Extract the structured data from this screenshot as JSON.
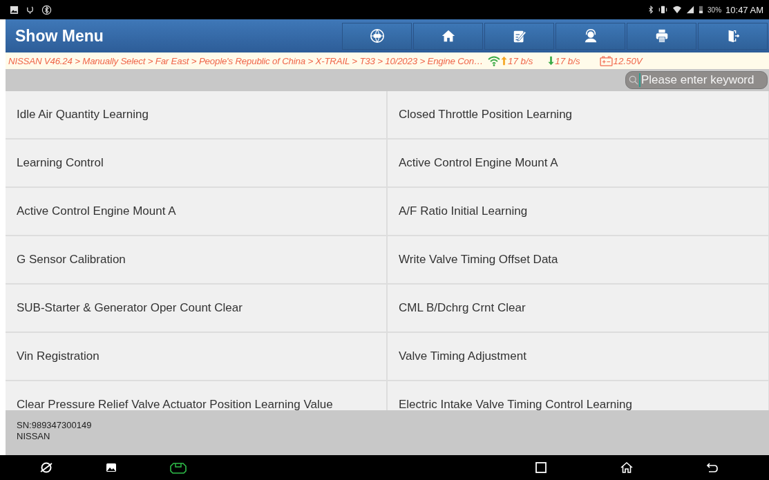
{
  "status_bar": {
    "battery": "30%",
    "time": "10:47 AM"
  },
  "header": {
    "title": "Show Menu"
  },
  "info_bar": {
    "breadcrumb": "NISSAN V46.24 > Manually Select > Far East > People's Republic of China > X-TRAIL > T33 > 10/2023 > Engine Con…",
    "upload": "17 b/s",
    "download": "17 b/s",
    "voltage": "12.50V"
  },
  "search": {
    "placeholder": "Please enter keyword"
  },
  "menu_items": [
    {
      "label": "Idle Air Quantity Learning"
    },
    {
      "label": "Closed Throttle Position Learning"
    },
    {
      "label": "Learning Control"
    },
    {
      "label": "Active Control Engine Mount A"
    },
    {
      "label": "Active Control Engine Mount A"
    },
    {
      "label": "A/F Ratio Initial Learning"
    },
    {
      "label": "G Sensor Calibration"
    },
    {
      "label": "Write Valve Timing Offset Data"
    },
    {
      "label": "SUB-Starter & Generator Oper Count Clear"
    },
    {
      "label": "CML B/Dchrg Crnt Clear"
    },
    {
      "label": "Vin Registration"
    },
    {
      "label": "Valve Timing Adjustment"
    },
    {
      "label": "Clear Pressure Relief Valve Actuator Position Learning Value"
    },
    {
      "label": "Electric Intake Valve Timing Control Learning"
    }
  ],
  "footer": {
    "serial": "SN:989347300149",
    "brand": "NISSAN"
  }
}
